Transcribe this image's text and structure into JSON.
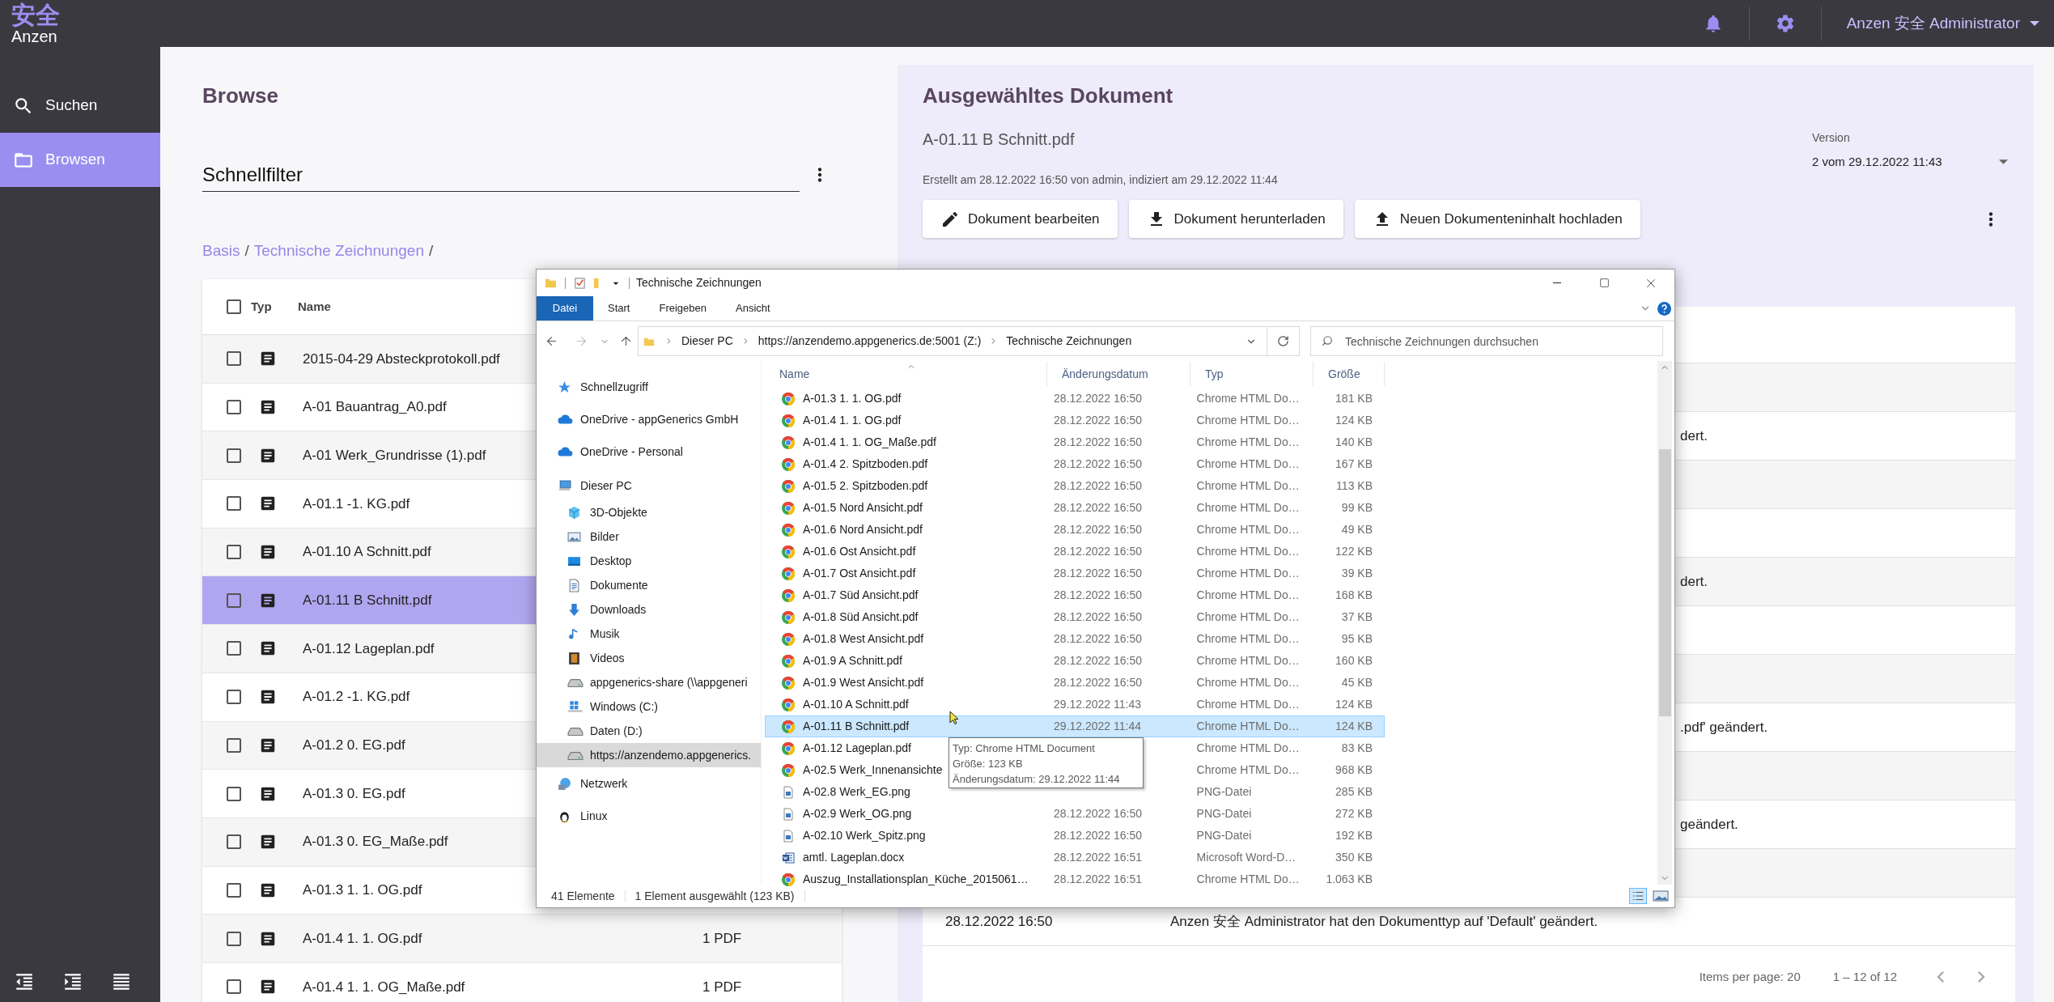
{
  "app_bar": {
    "logo_mark": "安全",
    "logo_text": "Anzen",
    "user_menu": "Anzen 安全 Administrator"
  },
  "sidebar": {
    "items": [
      {
        "label": "Suchen",
        "selected": false
      },
      {
        "label": "Browsen",
        "selected": true
      }
    ]
  },
  "browse": {
    "title": "Browse",
    "quick_filter": {
      "placeholder": "Schnellfilter"
    },
    "breadcrumb": [
      {
        "label": "Basis",
        "link": true
      },
      {
        "label": "/",
        "link": false
      },
      {
        "label": "Technische Zeichnungen",
        "link": true
      },
      {
        "label": "/",
        "link": false
      }
    ],
    "table": {
      "columns": [
        "Typ",
        "Name"
      ],
      "header_checked": false,
      "rows": [
        {
          "name": "2015-04-29 Absteckprotokoll.pdf",
          "checked": false,
          "selected": false
        },
        {
          "name": "A-01 Bauantrag_A0.pdf",
          "checked": false,
          "selected": false
        },
        {
          "name": "A-01 Werk_Grundrisse (1).pdf",
          "checked": false,
          "selected": false
        },
        {
          "name": "A-01.1 -1. KG.pdf",
          "checked": false,
          "selected": false
        },
        {
          "name": "A-01.10 A Schnitt.pdf",
          "checked": false,
          "selected": false
        },
        {
          "name": "A-01.11 B Schnitt.pdf",
          "checked": false,
          "selected": true
        },
        {
          "name": "A-01.12 Lageplan.pdf",
          "checked": false,
          "selected": false
        },
        {
          "name": "A-01.2 -1. KG.pdf",
          "checked": false,
          "selected": false
        },
        {
          "name": "A-01.2 0. EG.pdf",
          "checked": false,
          "selected": false
        },
        {
          "name": "A-01.3 0. EG.pdf",
          "checked": false,
          "selected": false
        },
        {
          "name": "A-01.3 0. EG_Maße.pdf",
          "checked": false,
          "selected": false
        },
        {
          "name": "A-01.3 1. 1. OG.pdf",
          "checked": false,
          "selected": false
        },
        {
          "name": "A-01.4 1. 1. OG.pdf",
          "count": "1 PDF",
          "checked": false,
          "selected": false
        },
        {
          "name": "A-01.4 1. 1. OG_Maße.pdf",
          "count": "1 PDF",
          "checked": false,
          "selected": false
        }
      ]
    }
  },
  "document": {
    "title": "Ausgewähltes Dokument",
    "name": "A-01.11 B Schnitt.pdf",
    "meta": "Erstellt am 28.12.2022 16:50 von admin, indiziert am 29.12.2022 11:44",
    "version": {
      "label": "Version",
      "value": "2 vom 29.12.2022 11:43"
    },
    "actions": [
      {
        "label": "Dokument bearbeiten",
        "kind": "edit"
      },
      {
        "label": "Dokument herunterladen",
        "kind": "download"
      },
      {
        "label": "Neuen Dokumenteninhalt hochladen",
        "kind": "upload"
      }
    ],
    "history": {
      "rows": [
        {
          "kind": "hidden"
        },
        {
          "kind": "partial",
          "text": "dert."
        },
        {
          "kind": "hidden"
        },
        {
          "kind": "hidden"
        },
        {
          "kind": "partial",
          "text": "dert."
        },
        {
          "kind": "hidden"
        },
        {
          "kind": "hidden"
        },
        {
          "kind": "partial",
          "text": ".pdf' geändert."
        },
        {
          "kind": "hidden"
        },
        {
          "kind": "partial",
          "text": "geändert."
        },
        {
          "kind": "hidden"
        },
        {
          "kind": "full",
          "date": "28.12.2022 16:50",
          "text": "Anzen 安全 Administrator hat den Dokumenttyp auf 'Default' geändert."
        }
      ],
      "items_per_page": "Items per page: 20",
      "range": "1 – 12 of 12"
    }
  },
  "explorer": {
    "title": "Technische Zeichnungen",
    "ribbon_tabs": [
      {
        "label": "Datei",
        "selected": true
      },
      {
        "label": "Start",
        "selected": false
      },
      {
        "label": "Freigeben",
        "selected": false
      },
      {
        "label": "Ansicht",
        "selected": false
      }
    ],
    "address": [
      "Dieser PC",
      "https://anzendemo.appgenerics.de:5001 (Z:)",
      "Technische Zeichnungen"
    ],
    "search": {
      "placeholder": "Technische Zeichnungen durchsuchen"
    },
    "nav": [
      {
        "label": "Schnellzugriff",
        "selected": false
      },
      {
        "label": "OneDrive - appGenerics GmbH",
        "selected": false
      },
      {
        "label": "OneDrive - Personal",
        "selected": false
      },
      {
        "label": "Dieser PC",
        "selected": false,
        "children": [
          {
            "label": "3D-Objekte",
            "selected": false
          },
          {
            "label": "Bilder",
            "selected": false
          },
          {
            "label": "Desktop",
            "selected": false
          },
          {
            "label": "Dokumente",
            "selected": false
          },
          {
            "label": "Downloads",
            "selected": false
          },
          {
            "label": "Musik",
            "selected": false
          },
          {
            "label": "Videos",
            "selected": false
          },
          {
            "label": "appgenerics-share (\\\\appgeneri",
            "selected": false
          },
          {
            "label": "Windows (C:)",
            "selected": false
          },
          {
            "label": "Daten (D:)",
            "selected": false
          },
          {
            "label": "https://anzendemo.appgenerics.",
            "selected": true
          }
        ]
      },
      {
        "label": "Netzwerk",
        "selected": false
      },
      {
        "label": "Linux",
        "selected": false
      }
    ],
    "columns": [
      "Name",
      "Änderungsdatum",
      "Typ",
      "Größe"
    ],
    "files": [
      {
        "kind": "chrome",
        "name": "A-01.3 1. 1. OG.pdf",
        "date": "28.12.2022 16:50",
        "type": "Chrome HTML Do…",
        "size": "181 KB",
        "selected": false
      },
      {
        "kind": "chrome",
        "name": "A-01.4 1. 1. OG.pdf",
        "date": "28.12.2022 16:50",
        "type": "Chrome HTML Do…",
        "size": "124 KB",
        "selected": false
      },
      {
        "kind": "chrome",
        "name": "A-01.4 1. 1. OG_Maße.pdf",
        "date": "28.12.2022 16:50",
        "type": "Chrome HTML Do…",
        "size": "140 KB",
        "selected": false
      },
      {
        "kind": "chrome",
        "name": "A-01.4 2. Spitzboden.pdf",
        "date": "28.12.2022 16:50",
        "type": "Chrome HTML Do…",
        "size": "167 KB",
        "selected": false
      },
      {
        "kind": "chrome",
        "name": "A-01.5 2. Spitzboden.pdf",
        "date": "28.12.2022 16:50",
        "type": "Chrome HTML Do…",
        "size": "113 KB",
        "selected": false
      },
      {
        "kind": "chrome",
        "name": "A-01.5 Nord Ansicht.pdf",
        "date": "28.12.2022 16:50",
        "type": "Chrome HTML Do…",
        "size": "99 KB",
        "selected": false
      },
      {
        "kind": "chrome",
        "name": "A-01.6 Nord Ansicht.pdf",
        "date": "28.12.2022 16:50",
        "type": "Chrome HTML Do…",
        "size": "49 KB",
        "selected": false
      },
      {
        "kind": "chrome",
        "name": "A-01.6 Ost Ansicht.pdf",
        "date": "28.12.2022 16:50",
        "type": "Chrome HTML Do…",
        "size": "122 KB",
        "selected": false
      },
      {
        "kind": "chrome",
        "name": "A-01.7 Ost Ansicht.pdf",
        "date": "28.12.2022 16:50",
        "type": "Chrome HTML Do…",
        "size": "39 KB",
        "selected": false
      },
      {
        "kind": "chrome",
        "name": "A-01.7 Süd Ansicht.pdf",
        "date": "28.12.2022 16:50",
        "type": "Chrome HTML Do…",
        "size": "168 KB",
        "selected": false
      },
      {
        "kind": "chrome",
        "name": "A-01.8 Süd Ansicht.pdf",
        "date": "28.12.2022 16:50",
        "type": "Chrome HTML Do…",
        "size": "37 KB",
        "selected": false
      },
      {
        "kind": "chrome",
        "name": "A-01.8 West Ansicht.pdf",
        "date": "28.12.2022 16:50",
        "type": "Chrome HTML Do…",
        "size": "95 KB",
        "selected": false
      },
      {
        "kind": "chrome",
        "name": "A-01.9 A Schnitt.pdf",
        "date": "28.12.2022 16:50",
        "type": "Chrome HTML Do…",
        "size": "160 KB",
        "selected": false
      },
      {
        "kind": "chrome",
        "name": "A-01.9 West Ansicht.pdf",
        "date": "28.12.2022 16:50",
        "type": "Chrome HTML Do…",
        "size": "45 KB",
        "selected": false
      },
      {
        "kind": "chrome",
        "name": "A-01.10 A Schnitt.pdf",
        "date": "29.12.2022 11:43",
        "type": "Chrome HTML Do…",
        "size": "124 KB",
        "selected": false
      },
      {
        "kind": "chrome",
        "name": "A-01.11 B Schnitt.pdf",
        "date": "29.12.2022 11:44",
        "type": "Chrome HTML Do…",
        "size": "124 KB",
        "selected": true
      },
      {
        "kind": "chrome",
        "name": "A-01.12 Lageplan.pdf",
        "type": "Chrome HTML Do…",
        "size": "83 KB",
        "selected": false
      },
      {
        "kind": "chrome",
        "name": "A-02.5 Werk_Innenansichte",
        "type": "Chrome HTML Do…",
        "size": "968 KB",
        "selected": false
      },
      {
        "kind": "image",
        "name": "A-02.8 Werk_EG.png",
        "type": "PNG-Datei",
        "size": "285 KB",
        "selected": false
      },
      {
        "kind": "image",
        "name": "A-02.9 Werk_OG.png",
        "date": "28.12.2022 16:50",
        "type": "PNG-Datei",
        "size": "272 KB",
        "selected": false
      },
      {
        "kind": "image",
        "name": "A-02.10 Werk_Spitz.png",
        "date": "28.12.2022 16:50",
        "type": "PNG-Datei",
        "size": "192 KB",
        "selected": false
      },
      {
        "kind": "word",
        "name": "amtl. Lageplan.docx",
        "date": "28.12.2022 16:51",
        "type": "Microsoft Word-D…",
        "size": "350 KB",
        "selected": false
      },
      {
        "kind": "chrome",
        "name": "Auszug_Installationsplan_Küche_2015061…",
        "date": "28.12.2022 16:51",
        "type": "Chrome HTML Do…",
        "size": "1.063 KB",
        "selected": false
      }
    ],
    "tooltip": [
      "Typ: Chrome HTML Document",
      "Größe: 123 KB",
      "Änderungsdatum: 29.12.2022 11:44"
    ],
    "status": {
      "count": "41 Elemente",
      "selection": "1 Element ausgewählt (123 KB)"
    }
  }
}
